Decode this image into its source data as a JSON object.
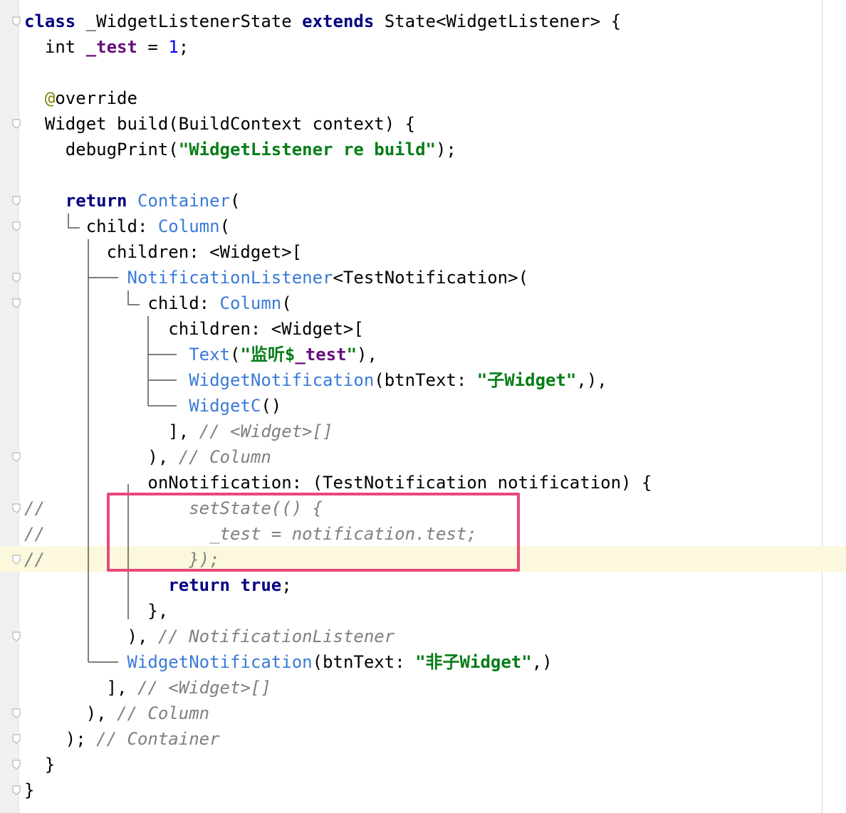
{
  "editor": {
    "lines": [
      {
        "indent": "",
        "tokens": [
          {
            "t": "class",
            "c": "kw"
          },
          {
            "t": " _WidgetListenerState "
          },
          {
            "t": "extends",
            "c": "kw"
          },
          {
            "t": " State<WidgetListener> {"
          }
        ]
      },
      {
        "indent": "  ",
        "tokens": [
          {
            "t": "int "
          },
          {
            "t": "_test",
            "c": "field"
          },
          {
            "t": " = "
          },
          {
            "t": "1",
            "c": "num"
          },
          {
            "t": ";"
          }
        ]
      },
      {
        "indent": "",
        "tokens": []
      },
      {
        "indent": "  ",
        "tokens": [
          {
            "t": "@",
            "c": "ann"
          },
          {
            "t": "override"
          }
        ]
      },
      {
        "indent": "  ",
        "tokens": [
          {
            "t": "Widget build(BuildContext context) {"
          }
        ]
      },
      {
        "indent": "    ",
        "tokens": [
          {
            "t": "debugPrint("
          },
          {
            "t": "\"WidgetListener re build\"",
            "c": "str"
          },
          {
            "t": ");"
          }
        ]
      },
      {
        "indent": "",
        "tokens": []
      },
      {
        "indent": "    ",
        "tokens": [
          {
            "t": "return",
            "c": "kw"
          },
          {
            "t": " "
          },
          {
            "t": "Container",
            "c": "type"
          },
          {
            "t": "("
          }
        ]
      },
      {
        "indent": "      ",
        "tokens": [
          {
            "t": "child: "
          },
          {
            "t": "Column",
            "c": "type"
          },
          {
            "t": "("
          }
        ]
      },
      {
        "indent": "        ",
        "tokens": [
          {
            "t": "children: <Widget>["
          }
        ]
      },
      {
        "indent": "          ",
        "tokens": [
          {
            "t": "NotificationListener",
            "c": "type"
          },
          {
            "t": "<TestNotification>("
          }
        ]
      },
      {
        "indent": "            ",
        "tokens": [
          {
            "t": "child: "
          },
          {
            "t": "Column",
            "c": "type"
          },
          {
            "t": "("
          }
        ]
      },
      {
        "indent": "              ",
        "tokens": [
          {
            "t": "children: <Widget>["
          }
        ]
      },
      {
        "indent": "                ",
        "tokens": [
          {
            "t": "Text",
            "c": "type"
          },
          {
            "t": "("
          },
          {
            "t": "\"监听$",
            "c": "str"
          },
          {
            "t": "_test",
            "c": "field"
          },
          {
            "t": "\"",
            "c": "str"
          },
          {
            "t": "),"
          }
        ]
      },
      {
        "indent": "                ",
        "tokens": [
          {
            "t": "WidgetNotification",
            "c": "type"
          },
          {
            "t": "(btnText: "
          },
          {
            "t": "\"子Widget\"",
            "c": "str"
          },
          {
            "t": ",),"
          }
        ]
      },
      {
        "indent": "                ",
        "tokens": [
          {
            "t": "WidgetC",
            "c": "type"
          },
          {
            "t": "()"
          }
        ]
      },
      {
        "indent": "              ",
        "tokens": [
          {
            "t": "], "
          },
          {
            "t": "// <Widget>[]",
            "c": "cmt"
          }
        ]
      },
      {
        "indent": "            ",
        "tokens": [
          {
            "t": "), "
          },
          {
            "t": "// Column",
            "c": "cmt"
          }
        ]
      },
      {
        "indent": "            ",
        "tokens": [
          {
            "t": "onNotification: (TestNotification notification) {"
          }
        ]
      },
      {
        "indent": "",
        "tokens": [
          {
            "t": "//",
            "c": "cmt"
          },
          {
            "t": "              setState(() {",
            "c": "cmt"
          }
        ]
      },
      {
        "indent": "",
        "tokens": [
          {
            "t": "//",
            "c": "cmt"
          },
          {
            "t": "                _test = notification.test;",
            "c": "cmt"
          }
        ]
      },
      {
        "indent": "",
        "tokens": [
          {
            "t": "//",
            "c": "cmt"
          },
          {
            "t": "              });",
            "c": "cmt"
          }
        ]
      },
      {
        "indent": "              ",
        "tokens": [
          {
            "t": "return",
            "c": "kw"
          },
          {
            "t": " "
          },
          {
            "t": "true",
            "c": "kw"
          },
          {
            "t": ";"
          }
        ]
      },
      {
        "indent": "            ",
        "tokens": [
          {
            "t": "},"
          }
        ]
      },
      {
        "indent": "          ",
        "tokens": [
          {
            "t": "), "
          },
          {
            "t": "// NotificationListener",
            "c": "cmt"
          }
        ]
      },
      {
        "indent": "          ",
        "tokens": [
          {
            "t": "WidgetNotification",
            "c": "type"
          },
          {
            "t": "(btnText: "
          },
          {
            "t": "\"非子Widget\"",
            "c": "str"
          },
          {
            "t": ",)"
          }
        ]
      },
      {
        "indent": "        ",
        "tokens": [
          {
            "t": "], "
          },
          {
            "t": "// <Widget>[]",
            "c": "cmt"
          }
        ]
      },
      {
        "indent": "      ",
        "tokens": [
          {
            "t": "), "
          },
          {
            "t": "// Column",
            "c": "cmt"
          }
        ]
      },
      {
        "indent": "    ",
        "tokens": [
          {
            "t": "); "
          },
          {
            "t": "// Container",
            "c": "cmt"
          }
        ]
      },
      {
        "indent": "  ",
        "tokens": [
          {
            "t": "}"
          }
        ]
      },
      {
        "indent": "",
        "tokens": [
          {
            "t": "}"
          }
        ]
      }
    ]
  },
  "colors": {
    "keyword": "#000080",
    "type": "#3a7ad8",
    "field": "#660e7a",
    "number": "#0000ff",
    "string": "#067d17",
    "comment": "#808080",
    "annotation": "#808000",
    "highlight_box": "#e6497a",
    "current_line": "#fbf8dd"
  }
}
